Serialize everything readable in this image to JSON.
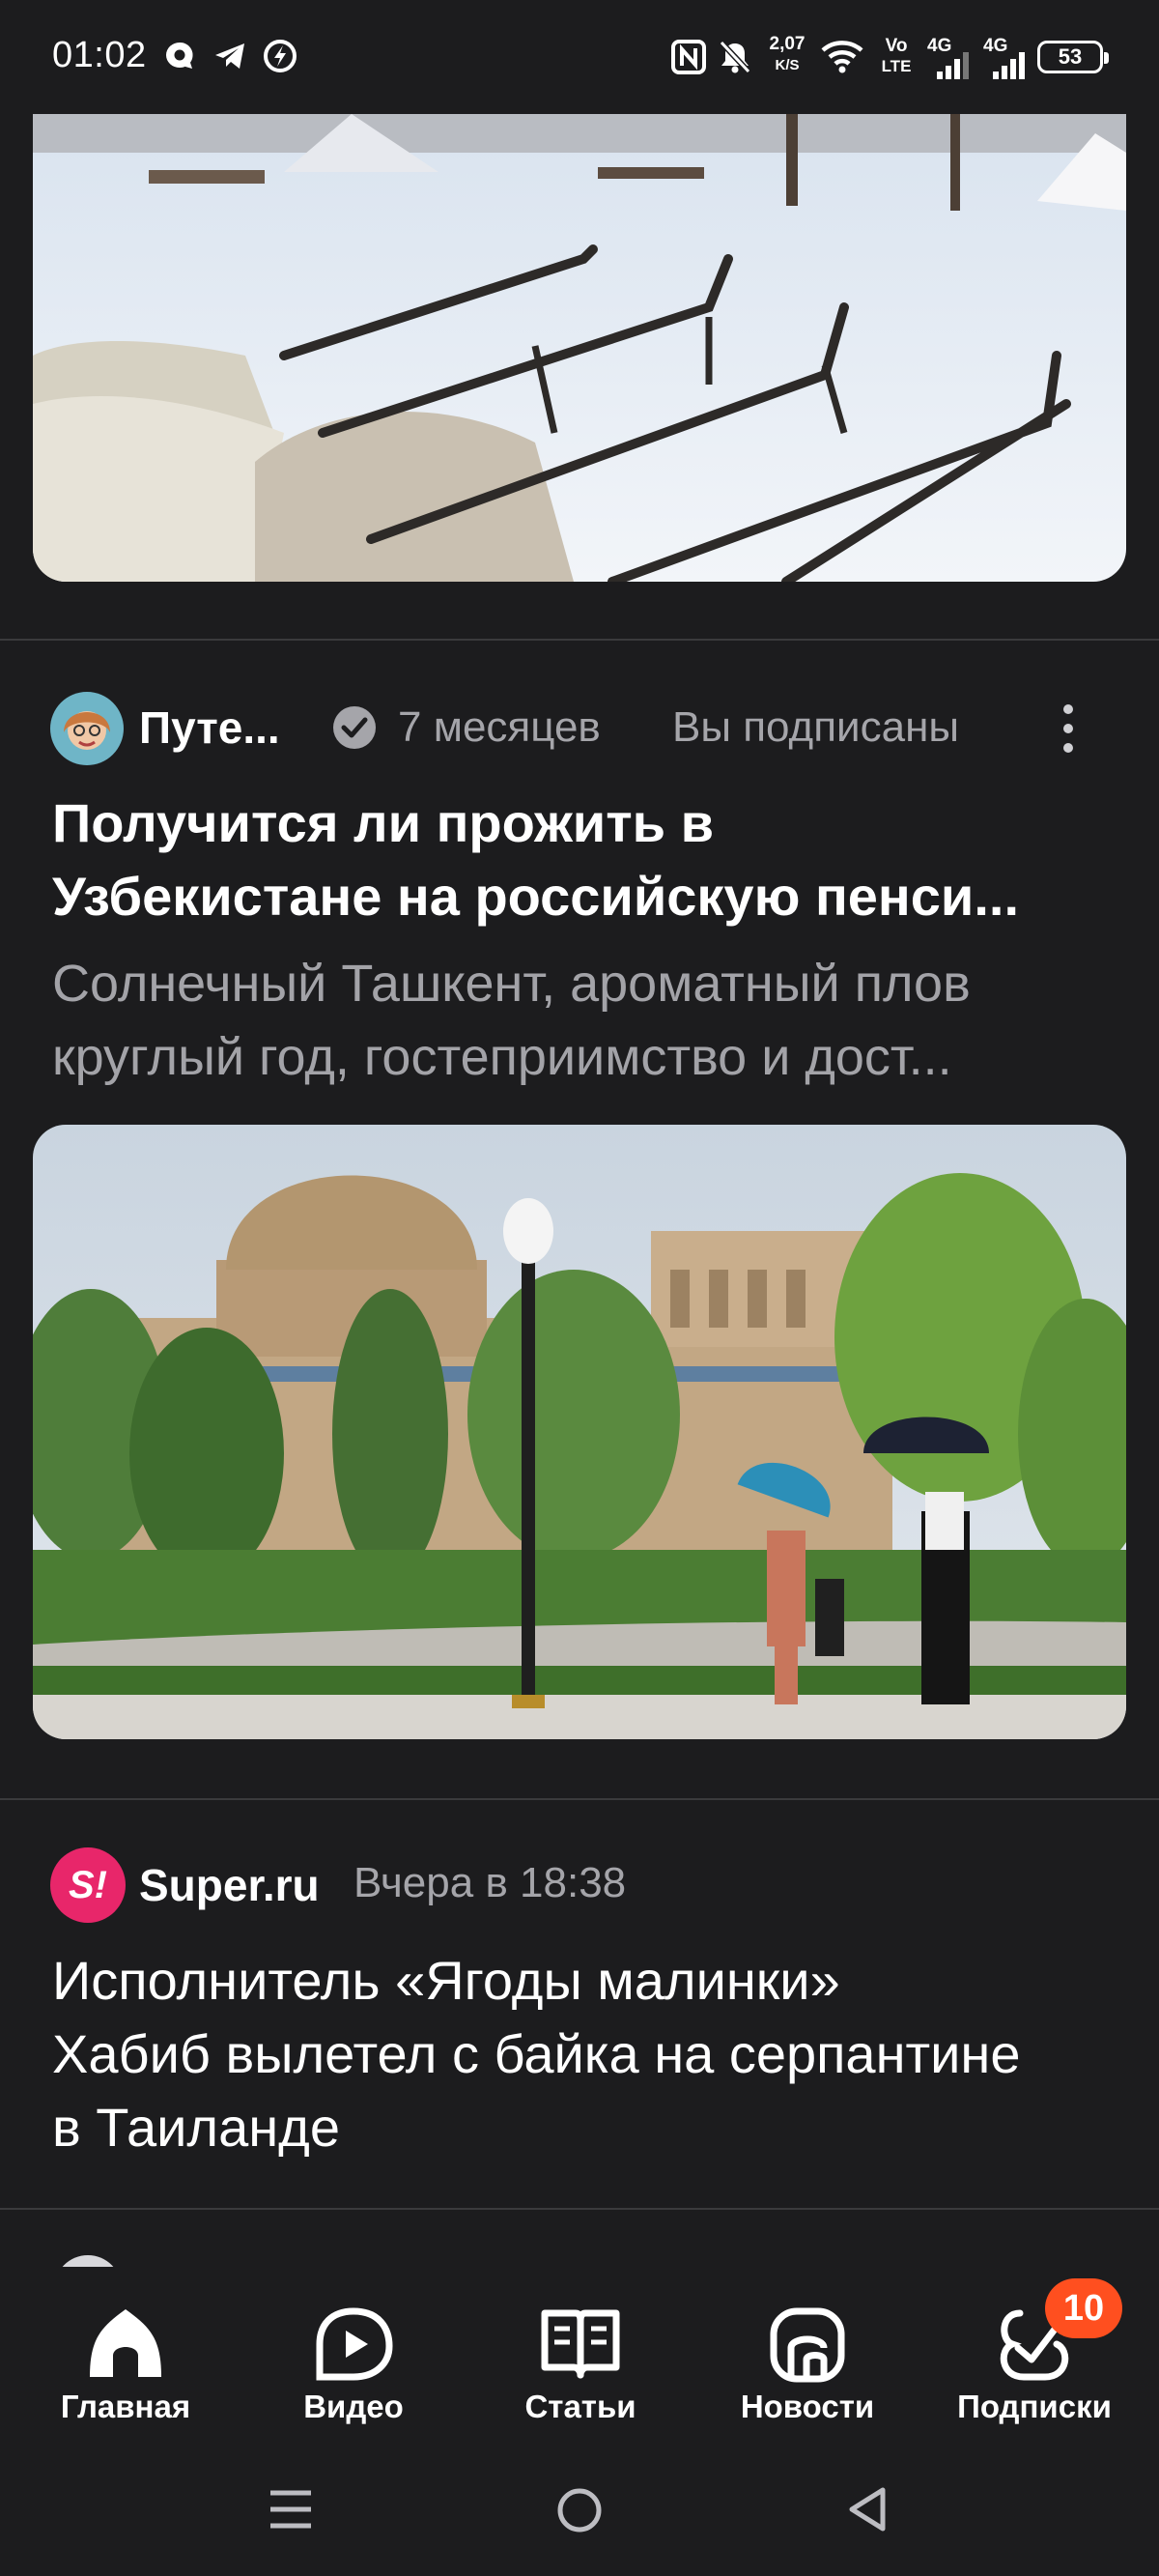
{
  "status_bar": {
    "time": "01:02",
    "speed_value": "2,07",
    "speed_unit": "K/S",
    "volte_top": "Vo",
    "volte_bottom": "LTE",
    "net1": "4G",
    "net2": "4G",
    "battery": "53"
  },
  "feed": {
    "post1": {
      "author": "Путе...",
      "age": "7 месяцев",
      "subscribed": "Вы подписаны",
      "title_line1": "Получится ли прожить в",
      "title_line2": "Узбекистане на российскую пенси...",
      "snippet_line1": "Солнечный Ташкент, ароматный плов",
      "snippet_line2": "круглый год, гостеприимство и дост..."
    },
    "post2": {
      "source_logo": "S!",
      "source": "Super.ru",
      "time": "Вчера в 18:38",
      "headline_line1": "Исполнитель «Ягоды малинки»",
      "headline_line2": "Хабиб вылетел с байка на серпантине",
      "headline_line3": "в Таиланде"
    }
  },
  "bottom_nav": {
    "items": [
      {
        "label": "Главная",
        "icon": "home-icon"
      },
      {
        "label": "Видео",
        "icon": "video-play-icon"
      },
      {
        "label": "Статьи",
        "icon": "book-icon"
      },
      {
        "label": "Новости",
        "icon": "news-icon"
      },
      {
        "label": "Подписки",
        "icon": "subscriptions-icon"
      }
    ],
    "badge_count": "10"
  },
  "colors": {
    "background": "#1c1c1e",
    "badge": "#ff4f1f",
    "source_logo": "#e8266a",
    "muted_text": "#a5a5aa"
  }
}
